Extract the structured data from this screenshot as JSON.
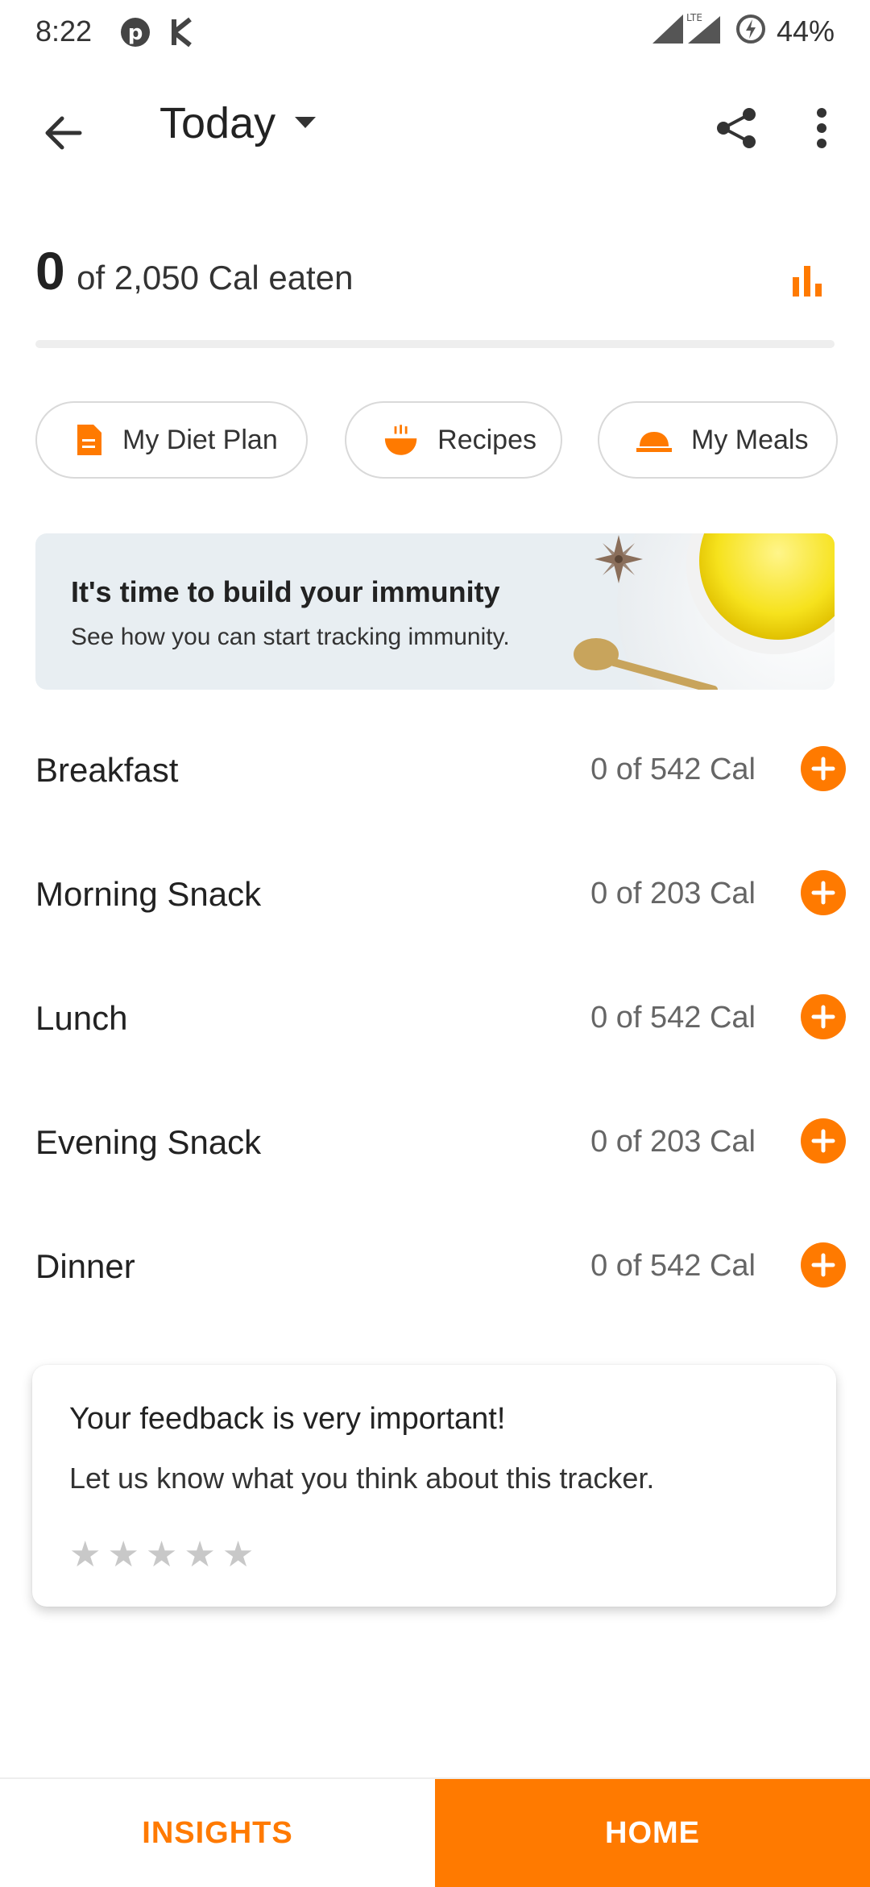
{
  "status_bar": {
    "time": "8:22",
    "battery": "44%",
    "network": "LTE"
  },
  "appbar": {
    "date_label": "Today"
  },
  "calories": {
    "eaten": "0",
    "summary": "of 2,050 Cal eaten",
    "progress": 0
  },
  "chips": [
    {
      "label": "My Diet Plan",
      "icon": "document-icon"
    },
    {
      "label": "Recipes",
      "icon": "bowl-icon"
    },
    {
      "label": "My Meals",
      "icon": "cloche-icon"
    }
  ],
  "banner": {
    "title": "It's time to build your immunity",
    "subtitle": "See how you can start tracking immunity."
  },
  "meals": [
    {
      "name": "Breakfast",
      "cal": "0 of 542 Cal"
    },
    {
      "name": "Morning Snack",
      "cal": "0 of 203 Cal"
    },
    {
      "name": "Lunch",
      "cal": "0 of 542 Cal"
    },
    {
      "name": "Evening Snack",
      "cal": "0 of 203 Cal"
    },
    {
      "name": "Dinner",
      "cal": "0 of 542 Cal"
    }
  ],
  "feedback": {
    "title": "Your feedback is very important!",
    "subtitle": "Let us know what you think about this tracker.",
    "rating": 0,
    "max_rating": 5
  },
  "bottom_nav": {
    "insights": "INSIGHTS",
    "home": "HOME"
  },
  "colors": {
    "accent": "#ff7a00",
    "text": "#222222",
    "muted": "#666666"
  }
}
